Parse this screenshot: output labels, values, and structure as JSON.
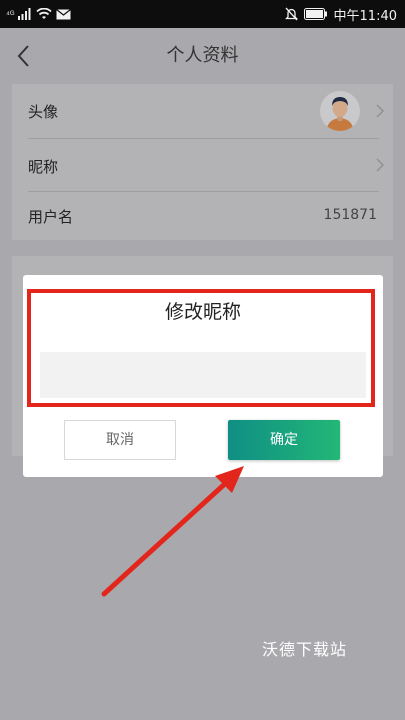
{
  "status_bar": {
    "signal_left": "⁴ᴳ",
    "time": "中午11:40",
    "icons": [
      "signal-icon",
      "wifi-icon",
      "mail-icon",
      "mute-icon",
      "battery-icon"
    ]
  },
  "navbar": {
    "title": "个人资料"
  },
  "profile": {
    "avatar_label": "头像",
    "nickname_label": "昵称",
    "username_label": "用户名",
    "username_value": "151871"
  },
  "dialog": {
    "title": "修改昵称",
    "input_value": "",
    "cancel_label": "取消",
    "confirm_label": "确定"
  },
  "watermark": "沃德下载站",
  "colors": {
    "highlight": "#e3261c",
    "confirm_gradient_start": "#0f8f84",
    "confirm_gradient_end": "#22b777",
    "overlay": "#a9a9ad"
  }
}
